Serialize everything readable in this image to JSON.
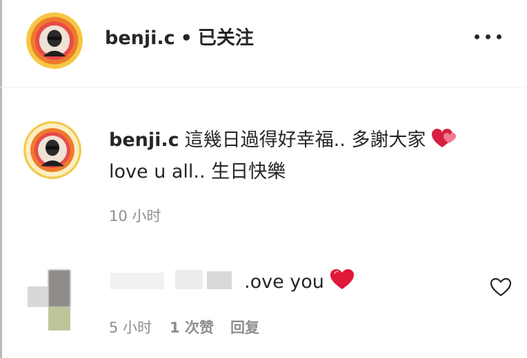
{
  "post_header": {
    "username": "benji.c",
    "separator": "•",
    "follow_status": "已关注"
  },
  "caption": {
    "username": "benji.c",
    "text_line1": "這幾日過得好幸福.. 多謝大家",
    "text_line2": "love u all.. 生日快樂",
    "time": "10 小时"
  },
  "comment": {
    "text": ".ove you",
    "time": "5 小时",
    "likes": "1 次赞",
    "reply": "回复"
  },
  "icons": {
    "more": "more-options-icon",
    "caption_heart": "two-hearts-emoji",
    "comment_heart": "red-heart-emoji",
    "like": "heart-outline-icon"
  },
  "colors": {
    "text": "#262626",
    "secondary": "#8e8e8e",
    "heart": "#e0183a",
    "avatar_ring": "#f4c430"
  }
}
